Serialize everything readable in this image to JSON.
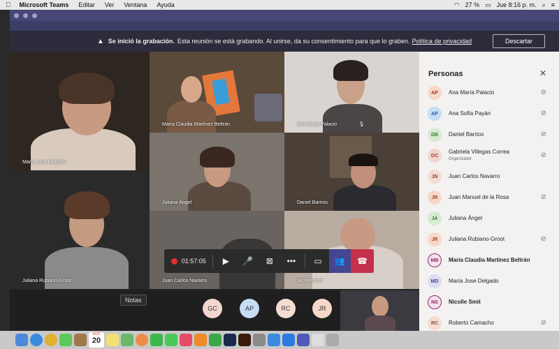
{
  "menubar": {
    "apple": "",
    "app": "Microsoft Teams",
    "items": [
      "Editar",
      "Ver",
      "Ventana",
      "Ayuda"
    ],
    "battery": "27 %",
    "clock": "Jue 8:16 p. m."
  },
  "recording_banner": {
    "bold": "Se inició la grabación.",
    "text": "Esta reunión se está grabando. Al unirse, da su consentimiento para que lo graben.",
    "link": "Política de privacidad",
    "dismiss": "Descartar"
  },
  "tiles": [
    {
      "name": "María Jose Delgado"
    },
    {
      "name": "María Claudia Martínez Beltrán"
    },
    {
      "name": "Ana María Palacio"
    },
    {
      "name": "Juliana Ángel"
    },
    {
      "name": "Daniel Barrios"
    },
    {
      "name": "Juliana Rubiano-Groot"
    },
    {
      "name": "Juan Carlos Navarro"
    },
    {
      "name": "Nicolle Smit"
    }
  ],
  "callbar": {
    "timer": "01:57:05"
  },
  "bottom_avatars": [
    "GC",
    "AP",
    "RC",
    "JR"
  ],
  "tooltip": "Notas",
  "panel": {
    "title": "Personas",
    "people": [
      {
        "initials": "AP",
        "name": "Ana María Palacio",
        "role": "",
        "muted": true,
        "bold": false,
        "bg": "#f9d6c6",
        "fg": "#9b3a1e"
      },
      {
        "initials": "AP",
        "name": "Ana Sofía Payán",
        "role": "",
        "muted": true,
        "bold": false,
        "bg": "#c7dcf5",
        "fg": "#2a5a9a"
      },
      {
        "initials": "DB",
        "name": "Daniel Barrios",
        "role": "",
        "muted": true,
        "bold": false,
        "bg": "#d6ecd2",
        "fg": "#3a7a2e"
      },
      {
        "initials": "GC",
        "name": "Gabriela Villegas Correa",
        "role": "Organizador",
        "muted": true,
        "bold": false,
        "bg": "#f4d6d0",
        "fg": "#9a3a2a"
      },
      {
        "initials": "JN",
        "name": "Juan Carlos Navarro",
        "role": "",
        "muted": false,
        "bold": false,
        "bg": "#f4dcd2",
        "fg": "#8a4a3a"
      },
      {
        "initials": "JR",
        "name": "Juan Manuel de la Rosa",
        "role": "",
        "muted": true,
        "bold": false,
        "bg": "#f7d8c8",
        "fg": "#a04a2a"
      },
      {
        "initials": "JÁ",
        "name": "Juliana Ángel",
        "role": "",
        "muted": false,
        "bold": false,
        "bg": "#d6ecd2",
        "fg": "#3a7a2e"
      },
      {
        "initials": "JR",
        "name": "Juliana Rubiano-Groot",
        "role": "",
        "muted": true,
        "bold": false,
        "bg": "#f7d8c8",
        "fg": "#a04a2a"
      },
      {
        "initials": "MB",
        "name": "María Claudia Martínez Beltrán",
        "role": "",
        "muted": false,
        "bold": true,
        "bg": "#f4e0ec",
        "fg": "#8a2a6a"
      },
      {
        "initials": "MD",
        "name": "María Jose Delgado",
        "role": "",
        "muted": false,
        "bold": false,
        "bg": "#dcdcf0",
        "fg": "#4a4a8a"
      },
      {
        "initials": "NS",
        "name": "Nicolle Smit",
        "role": "",
        "muted": false,
        "bold": true,
        "bg": "#f4e0ec",
        "fg": "#8a2a6a"
      },
      {
        "initials": "RC",
        "name": "Roberto Camacho",
        "role": "",
        "muted": true,
        "bold": false,
        "bg": "#f4dcd2",
        "fg": "#8a4a3a"
      }
    ]
  },
  "dock": {
    "calendar_month": "AGO",
    "calendar_day": "20"
  }
}
